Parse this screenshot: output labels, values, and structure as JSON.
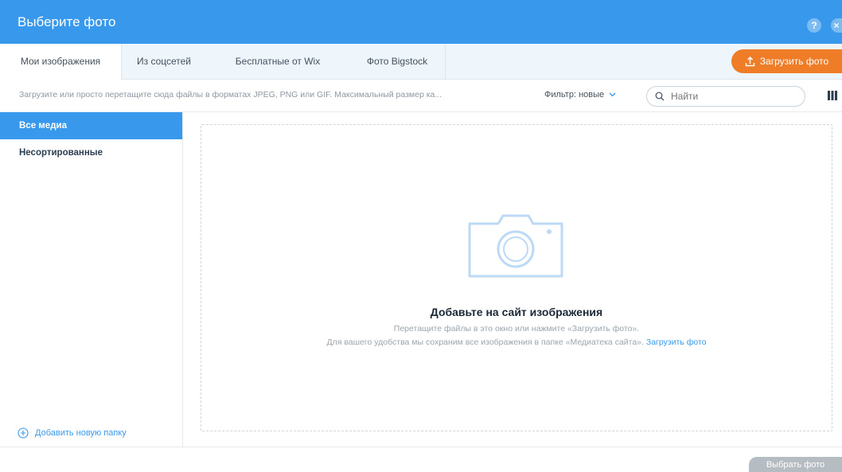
{
  "window": {
    "title": "Выберите фото",
    "help_label": "?",
    "close_label": "×"
  },
  "tabs": [
    {
      "label": "Мои изображения",
      "active": true
    },
    {
      "label": "Из соцсетей",
      "active": false
    },
    {
      "label": "Бесплатные от Wix",
      "active": false
    },
    {
      "label": "Фото Bigstock",
      "active": false
    }
  ],
  "toolbar": {
    "upload_label": "Загрузить фото",
    "hint": "Загрузите или просто перетащите сюда файлы в форматах JPEG, PNG или GIF. Максимальный размер ка...",
    "filter_label": "Фильтр: новые",
    "search_placeholder": "Найти",
    "search_value": ""
  },
  "sidebar": {
    "items": [
      {
        "label": "Все медиа",
        "active": true
      },
      {
        "label": "Несортированные",
        "active": false
      }
    ],
    "add_folder_label": "Добавить новую папку"
  },
  "dropzone": {
    "title": "Добавьте на сайт изображения",
    "line1": "Перетащите файлы в это окно или нажмите «Загрузить фото».",
    "line2": "Для вашего удобства мы сохраним все изображения в папке «Медиатека сайта».",
    "link_label": "Загрузить фото"
  },
  "footer": {
    "choose_label": "Выбрать фото"
  },
  "colors": {
    "accent": "#3899ec",
    "upload": "#ef7c27",
    "disabled": "#b5bcc2"
  }
}
